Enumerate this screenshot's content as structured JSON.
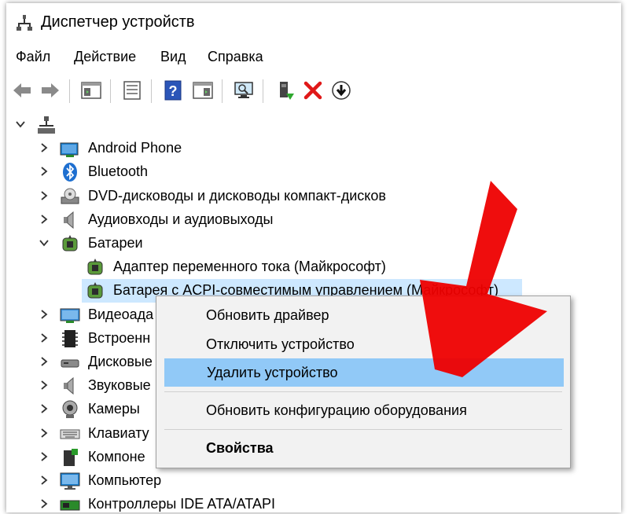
{
  "window": {
    "title": "Диспетчер устройств"
  },
  "menu": [
    "Файл",
    "Действие",
    "Вид",
    "Справка"
  ],
  "toolbar_icons": [
    "back-icon",
    "forward-icon",
    "properties-pane-icon",
    "properties-sheet-icon",
    "help-icon",
    "show-hidden-icon",
    "scan-hardware-icon",
    "update-driver-icon",
    "uninstall-icon",
    "disable-icon"
  ],
  "tree": {
    "root_icon": "computer-icon",
    "items": [
      {
        "label": "Android Phone",
        "icon": "android-phone-icon",
        "expanded": false
      },
      {
        "label": "Bluetooth",
        "icon": "bluetooth-icon",
        "expanded": false
      },
      {
        "label": "DVD-дисководы и дисководы компакт-дисков",
        "icon": "dvd-drive-icon",
        "expanded": false
      },
      {
        "label": "Аудиовходы и аудиовыходы",
        "icon": "speaker-icon",
        "expanded": false
      },
      {
        "label": "Батареи",
        "icon": "battery-icon",
        "expanded": true
      },
      {
        "label": "Адаптер переменного тока (Майкрософт)",
        "icon": "battery-icon",
        "child": true
      },
      {
        "label": "Батарея с ACPI-совместимым управлением (Майкрософт)",
        "icon": "battery-icon",
        "child": true,
        "selected": true
      },
      {
        "label": "Видеоада",
        "icon": "display-adapter-icon",
        "expanded": false
      },
      {
        "label": "Встроенн",
        "icon": "firmware-icon",
        "expanded": false
      },
      {
        "label": "Дисковые",
        "icon": "disk-drive-icon",
        "expanded": false
      },
      {
        "label": "Звуковые",
        "icon": "speaker-icon",
        "expanded": false
      },
      {
        "label": "Камеры",
        "icon": "camera-icon",
        "expanded": false
      },
      {
        "label": "Клавиату",
        "icon": "keyboard-icon",
        "expanded": false
      },
      {
        "label": "Компоне",
        "icon": "software-component-icon",
        "expanded": false
      },
      {
        "label": "Компьютер",
        "icon": "monitor-icon",
        "expanded": false
      },
      {
        "label": "Контроллеры IDE ATA/ATAPI",
        "icon": "ide-controller-icon",
        "expanded": false
      }
    ]
  },
  "context_menu": {
    "items": [
      {
        "label": "Обновить драйвер"
      },
      {
        "label": "Отключить устройство"
      },
      {
        "label": "Удалить устройство",
        "highlighted": true
      },
      {
        "label": "Обновить конфигурацию оборудования"
      },
      {
        "label": "Свойства",
        "bold": true
      }
    ]
  },
  "colors": {
    "selection": "#cde8ff",
    "menu_highlight": "#91c9f7",
    "arrow": "#ee0000"
  }
}
